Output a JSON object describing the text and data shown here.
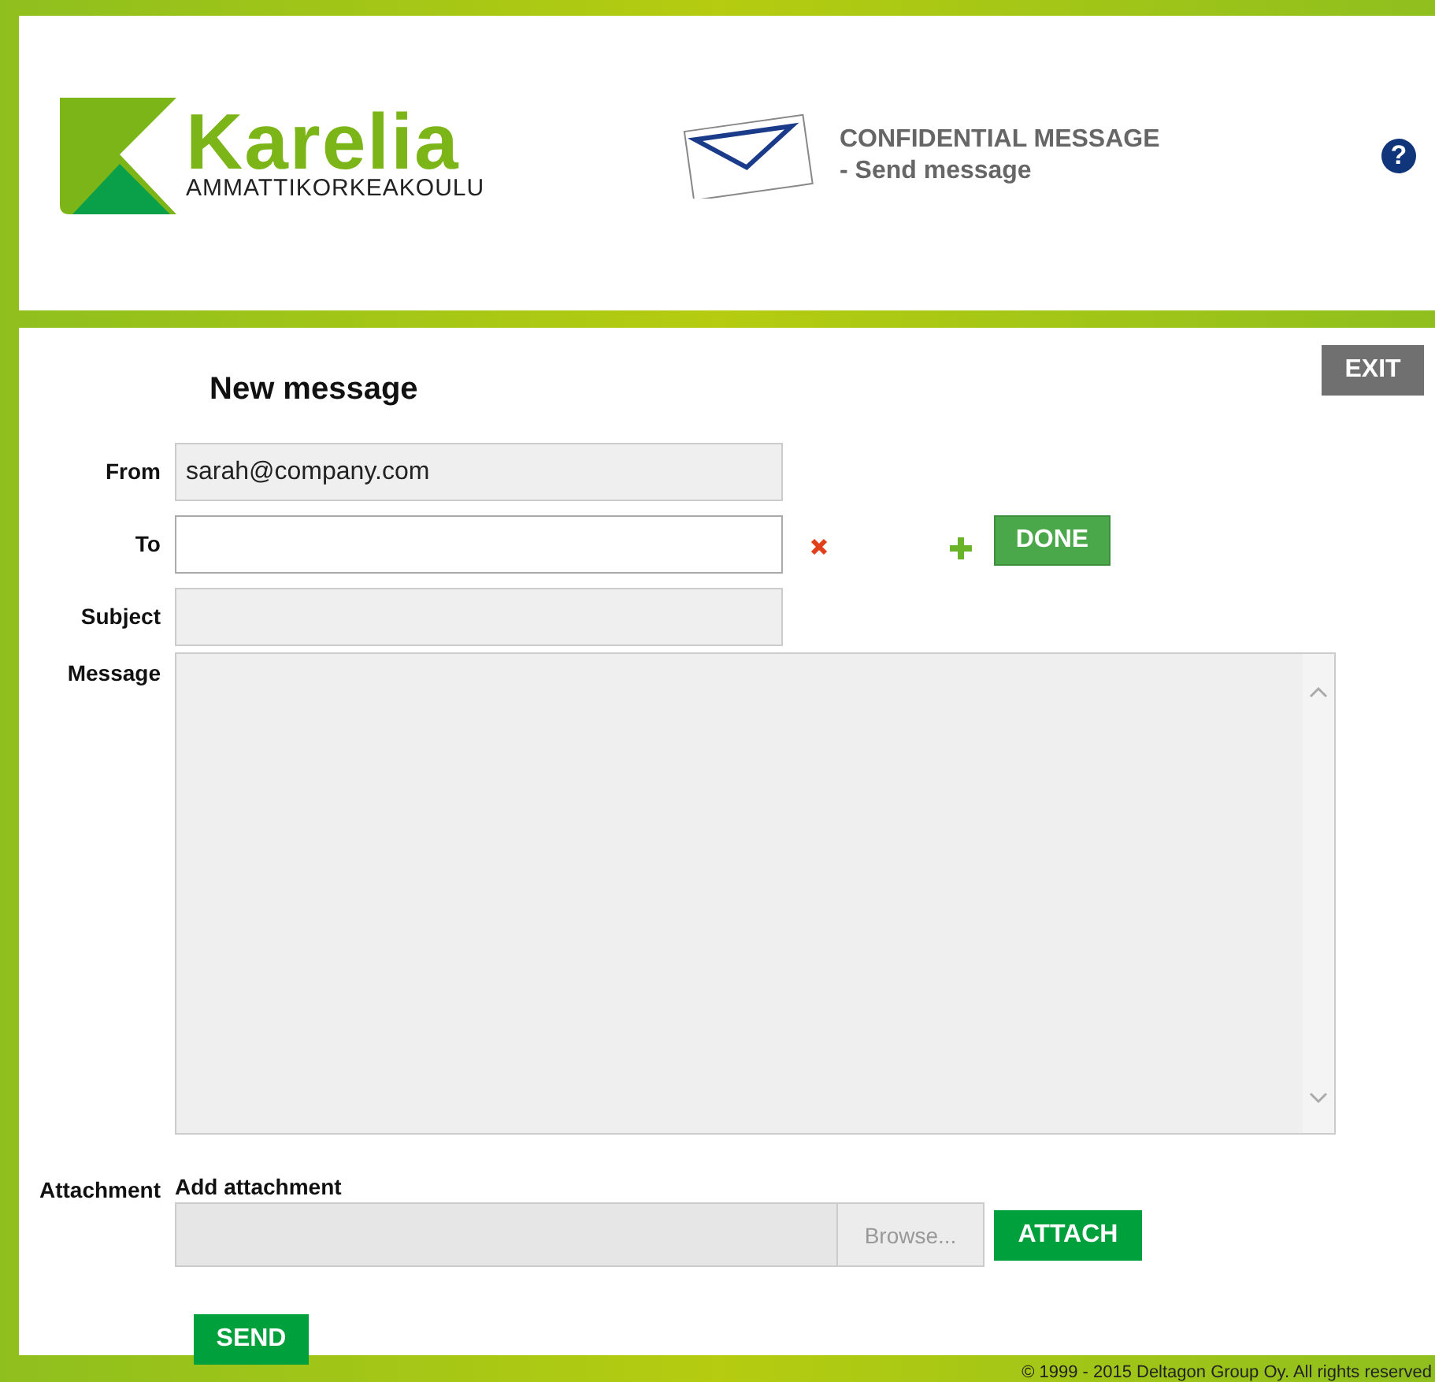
{
  "header": {
    "logo": {
      "name": "Karelia",
      "tagline": "AMMATTIKORKEAKOULU"
    },
    "title": "CONFIDENTIAL MESSAGE",
    "subtitle": "- Send message",
    "help": "?"
  },
  "exit_button": "EXIT",
  "heading": "New message",
  "form": {
    "from": {
      "label": "From",
      "value": "sarah@company.com"
    },
    "to": {
      "label": "To",
      "done_button": "DONE"
    },
    "subject": {
      "label": "Subject"
    },
    "message": {
      "label": "Message"
    },
    "attachment": {
      "label": "Attachment",
      "caption": "Add attachment",
      "browse_button": "Browse...",
      "attach_button": "ATTACH"
    }
  },
  "send_button": "SEND",
  "footer": "© 1999 - 2015 Deltagon Group Oy. All rights reserved"
}
